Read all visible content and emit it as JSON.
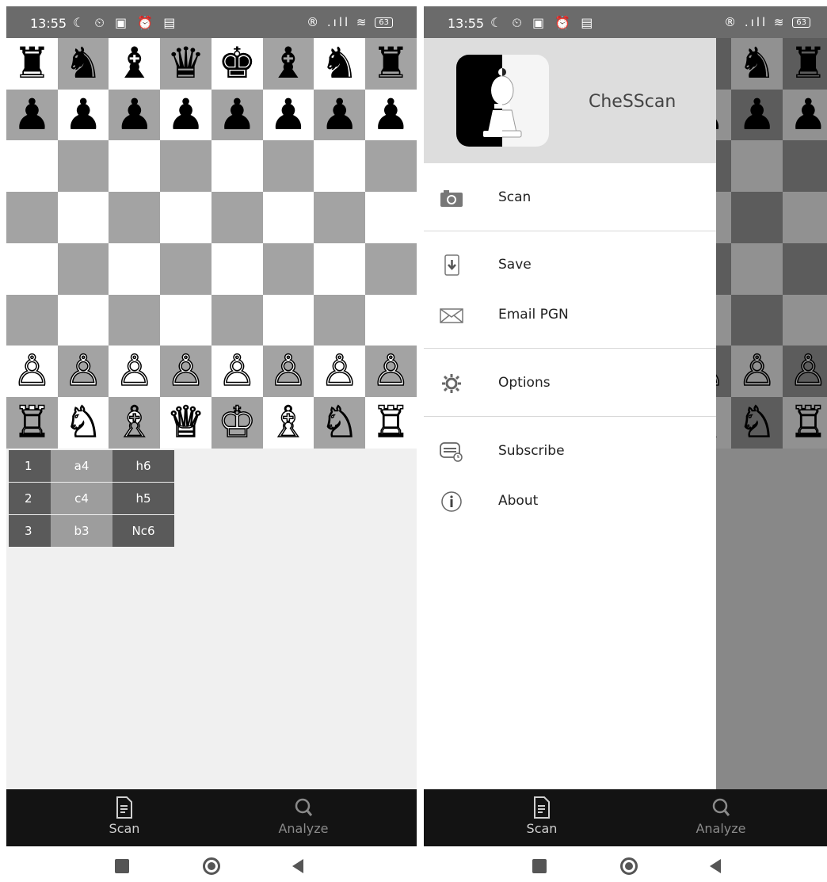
{
  "status": {
    "time": "13:55",
    "left_icons": "☾ ⏲ ▣ ⏰ ▤",
    "right_icons": "® .ıll ≋",
    "battery": "63"
  },
  "board": {
    "ranks": [
      [
        "♜",
        "♞",
        "♝",
        "♛",
        "♚",
        "♝",
        "♞",
        "♜"
      ],
      [
        "♟",
        "♟",
        "♟",
        "♟",
        "♟",
        "♟",
        "♟",
        "♟"
      ],
      [
        "",
        "",
        "",
        "",
        "",
        "",
        "",
        ""
      ],
      [
        "",
        "",
        "",
        "",
        "",
        "",
        "",
        ""
      ],
      [
        "",
        "",
        "",
        "",
        "",
        "",
        "",
        ""
      ],
      [
        "",
        "",
        "",
        "",
        "",
        "",
        "",
        ""
      ],
      [
        "♙",
        "♙",
        "♙",
        "♙",
        "♙",
        "♙",
        "♙",
        "♙"
      ],
      [
        "♖",
        "♘",
        "♗",
        "♕",
        "♔",
        "♗",
        "♘",
        "♖"
      ]
    ]
  },
  "moves": [
    {
      "no": "1",
      "white": "a4",
      "black": "h6"
    },
    {
      "no": "2",
      "white": "c4",
      "black": "h5"
    },
    {
      "no": "3",
      "white": "b3",
      "black": "Nc6"
    }
  ],
  "bottom_nav": {
    "scan_label": "Scan",
    "analyze_label": "Analyze"
  },
  "drawer": {
    "app_name": "CheSScan",
    "items": {
      "scan": "Scan",
      "save": "Save",
      "email": "Email PGN",
      "options": "Options",
      "subscribe": "Subscribe",
      "about": "About"
    }
  },
  "colors": {
    "light_square": "#ffffff",
    "dark_square": "#a3a3a3",
    "nav_bg": "#131313",
    "status_bg": "#6b6b6b"
  }
}
